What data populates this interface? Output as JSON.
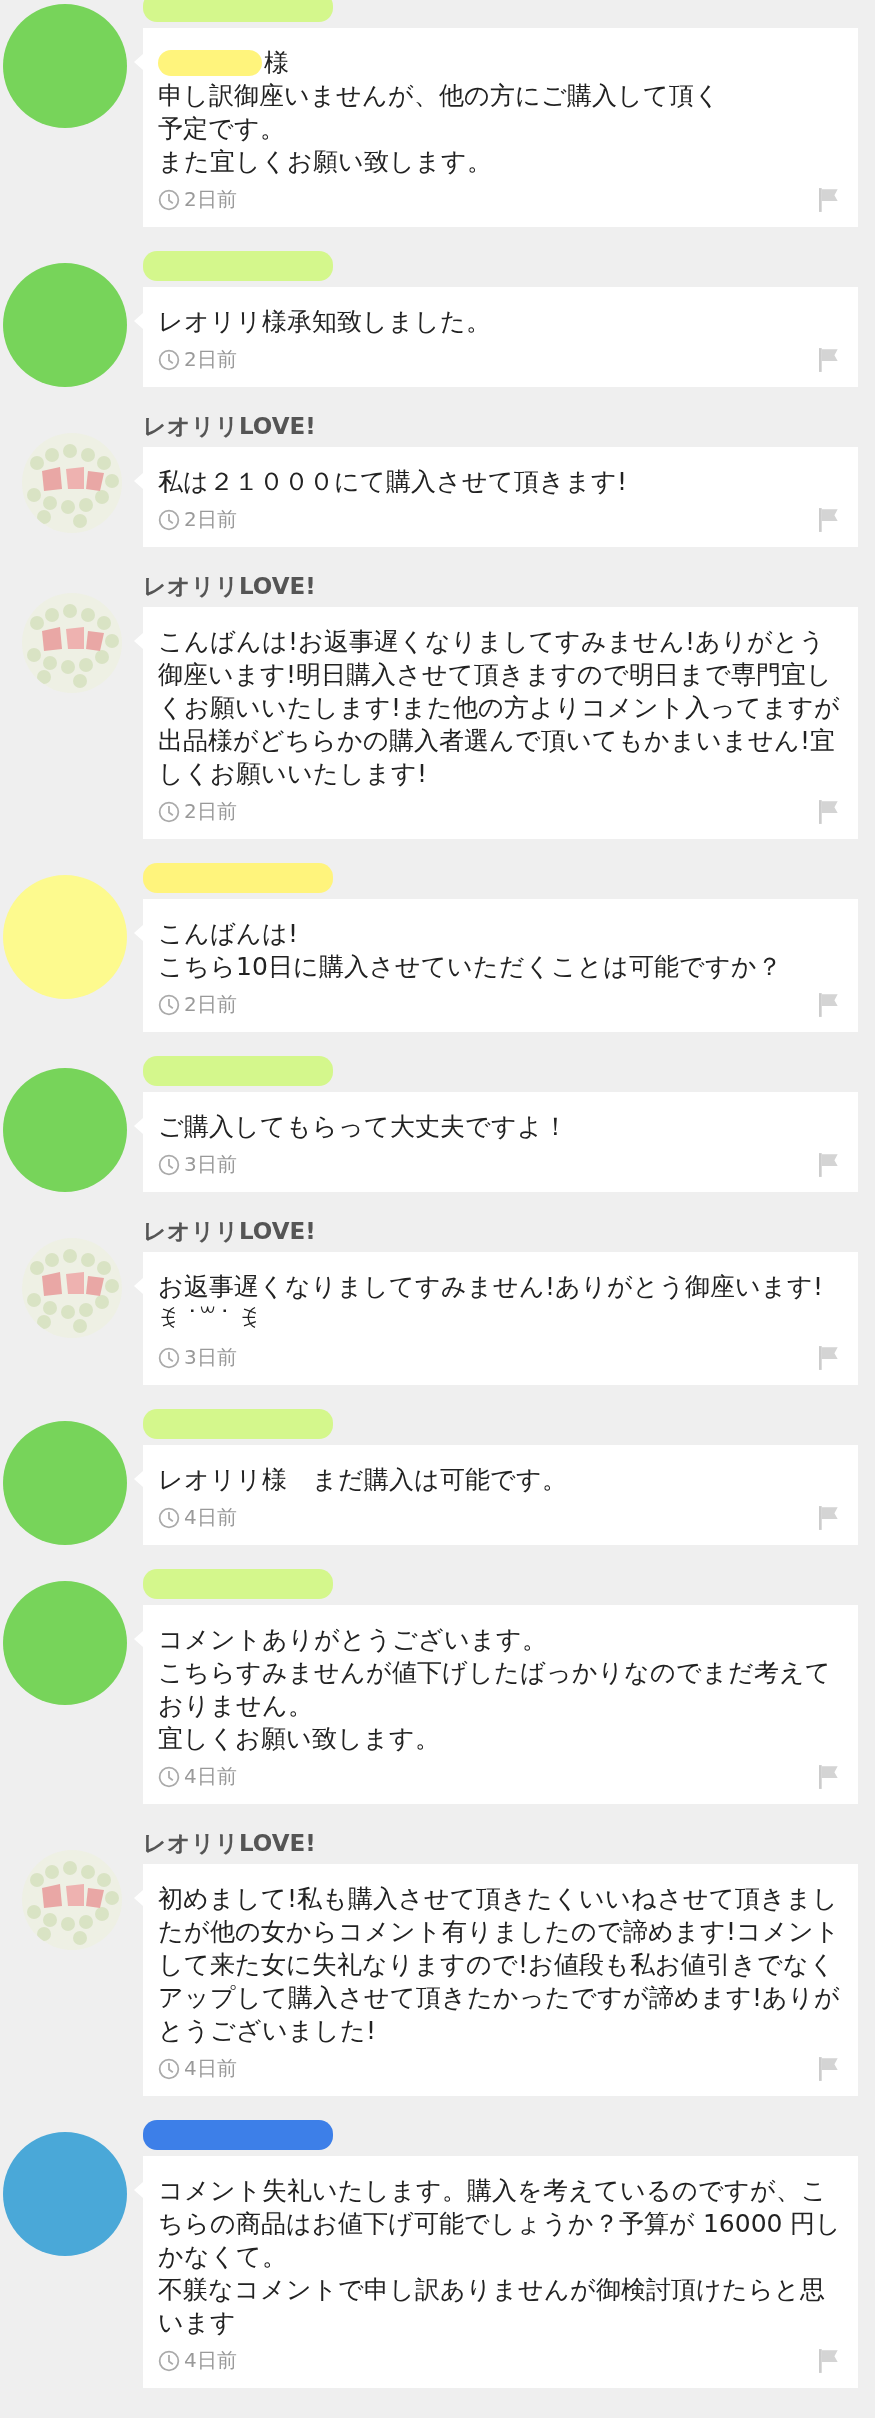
{
  "comments": [
    {
      "avatar": {
        "kind": "circle",
        "color": "#77d45a"
      },
      "author": {
        "kind": "redacted",
        "color": "#d4f78c"
      },
      "mention": {
        "color": "#fff47c",
        "suffix": "様"
      },
      "body": [
        "申し訳御座いませんが、他の方にご購入して頂く",
        "予定です。",
        "また宜しくお願い致します。"
      ],
      "time": "2日前"
    },
    {
      "avatar": {
        "kind": "circle",
        "color": "#77d45a"
      },
      "author": {
        "kind": "redacted",
        "color": "#d4f78c"
      },
      "body": [
        "レオリリ様承知致しました。"
      ],
      "time": "2日前"
    },
    {
      "avatar": {
        "kind": "picture"
      },
      "author": {
        "kind": "name",
        "text": "レオリリLOVE!"
      },
      "body": [
        "私は２１０００にて購入させて頂きます!"
      ],
      "time": "2日前"
    },
    {
      "avatar": {
        "kind": "picture"
      },
      "author": {
        "kind": "name",
        "text": "レオリリLOVE!"
      },
      "body": [
        "こんばんは!お返事遅くなりましてすみません!ありがとう御座います!明日購入させて頂きますので明日まで専門宜しくお願いいたします!また他の方よりコメント入ってますが出品様がどちらかの購入者選んで頂いてもかまいません!宜しくお願いいたします!"
      ],
      "time": "2日前"
    },
    {
      "avatar": {
        "kind": "circle",
        "color": "#fdfa8e"
      },
      "author": {
        "kind": "redacted",
        "color": "#fff47c"
      },
      "body": [
        "こんばんは!",
        "こちら10日に購入させていただくことは可能ですか？"
      ],
      "time": "2日前"
    },
    {
      "avatar": {
        "kind": "circle",
        "color": "#77d45a"
      },
      "author": {
        "kind": "redacted",
        "color": "#d4f78c"
      },
      "body": [
        "ご購入してもらって大丈夫ですよ！"
      ],
      "time": "3日前"
    },
    {
      "avatar": {
        "kind": "picture"
      },
      "author": {
        "kind": "name",
        "text": "レオリリLOVE!"
      },
      "body": [
        "お返事遅くなりましてすみません!ありがとう御座います!",
        "ꉂ ˙꒳˙ ꉂ"
      ],
      "time": "3日前"
    },
    {
      "avatar": {
        "kind": "circle",
        "color": "#77d45a"
      },
      "author": {
        "kind": "redacted",
        "color": "#d4f78c"
      },
      "body": [
        "レオリリ様　まだ購入は可能です。"
      ],
      "time": "4日前"
    },
    {
      "avatar": {
        "kind": "circle",
        "color": "#77d45a"
      },
      "author": {
        "kind": "redacted",
        "color": "#d4f78c"
      },
      "body": [
        "コメントありがとうございます。",
        "こちらすみませんが値下げしたばっかりなのでまだ考えておりません。",
        "宜しくお願い致します。"
      ],
      "time": "4日前"
    },
    {
      "avatar": {
        "kind": "picture"
      },
      "author": {
        "kind": "name",
        "text": "レオリリLOVE!"
      },
      "body": [
        "初めまして!私も購入させて頂きたくいいねさせて頂きましたが他の女からコメント有りましたので諦めます!コメントして来た女に失礼なりますので!お値段も私お値引きでなくアップして購入させて頂きたかったですが諦めます!ありがとうございました!"
      ],
      "time": "4日前"
    },
    {
      "avatar": {
        "kind": "circle",
        "color": "#4aa8d8"
      },
      "author": {
        "kind": "redacted",
        "color": "#3d7fe8"
      },
      "body": [
        "コメント失礼いたします。購入を考えているのですが、こちらの商品はお値下げ可能でしょうか？予算が 16000 円しかなくて。",
        "不躾なコメントで申し訳ありませんが御検討頂けたらと思います"
      ],
      "time": "4日前"
    }
  ]
}
